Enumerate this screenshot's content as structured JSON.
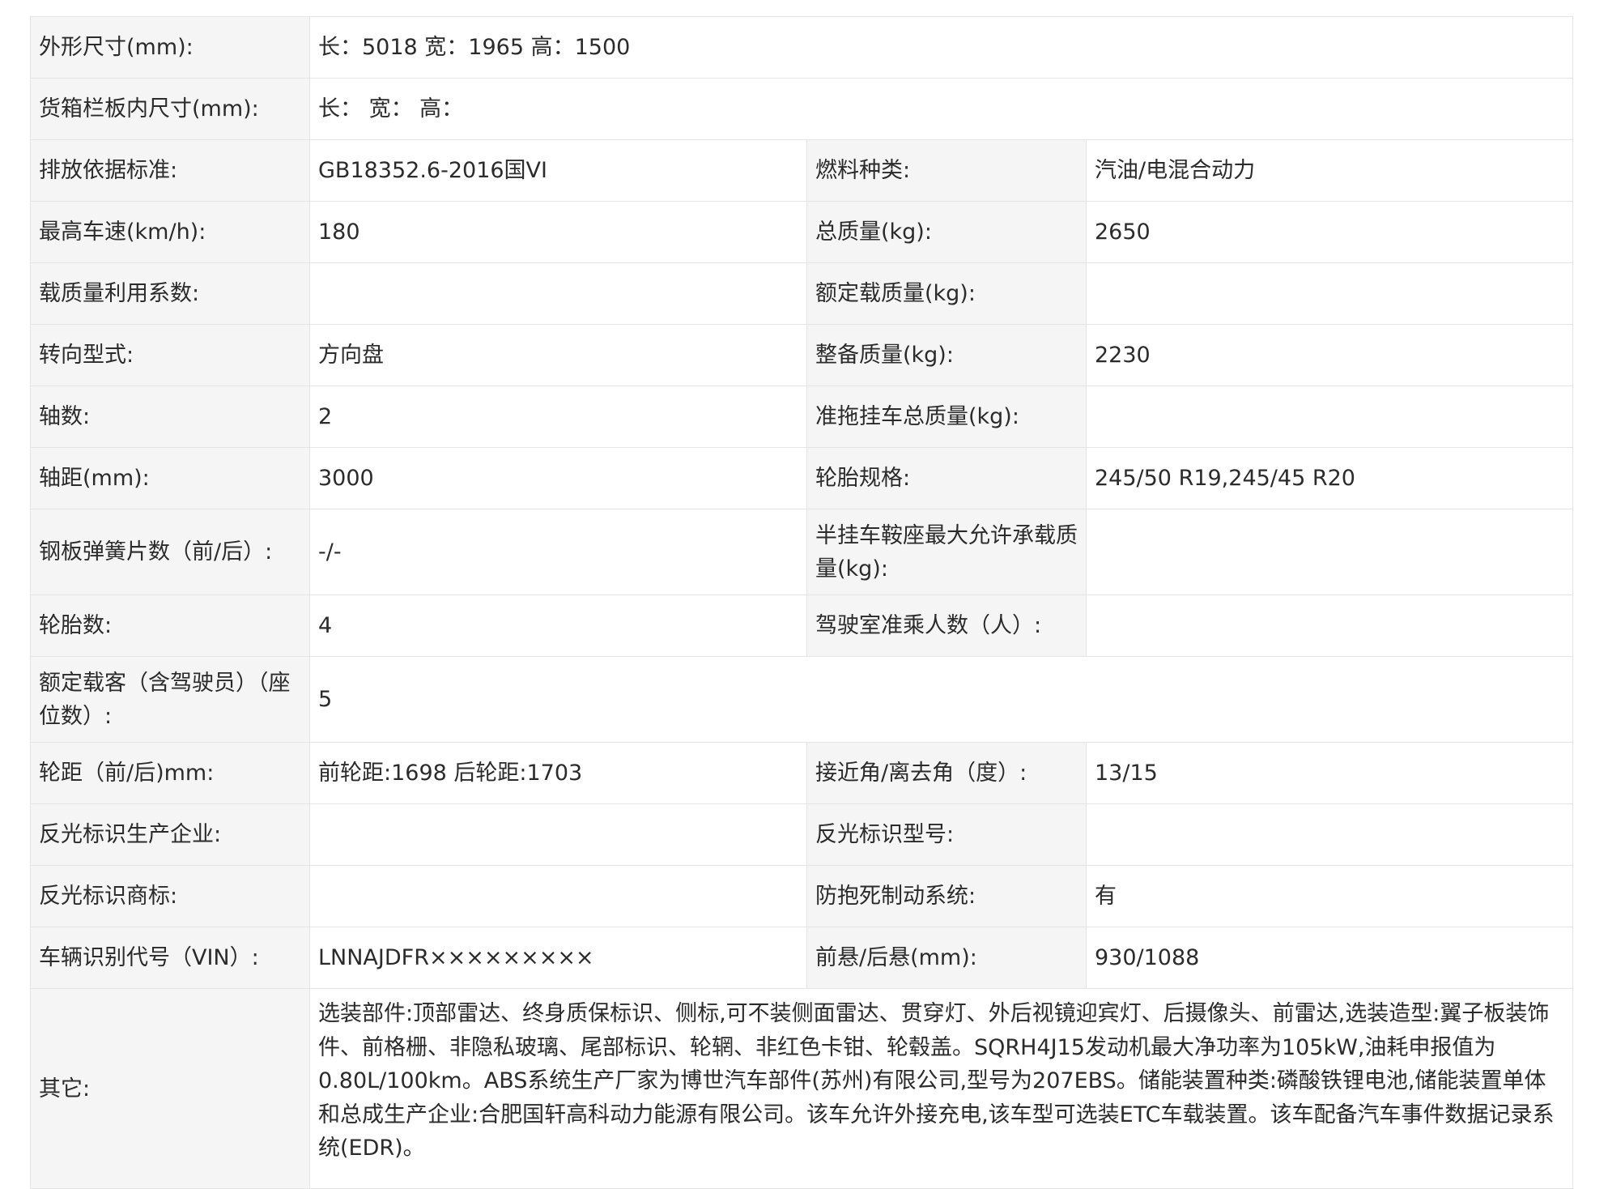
{
  "rows": {
    "dims": {
      "label": "外形尺寸(mm):",
      "value": "长：5018 宽：1965 高：1500"
    },
    "cargo": {
      "label": "货箱栏板内尺寸(mm):",
      "value": "长：  宽：  高："
    },
    "emission": {
      "label": "排放依据标准:",
      "value": "GB18352.6-2016国VI",
      "label2": "燃料种类:",
      "value2": "汽油/电混合动力"
    },
    "speed": {
      "label": "最高车速(km/h):",
      "value": "180",
      "label2": "总质量(kg):",
      "value2": "2650"
    },
    "load_factor": {
      "label": "载质量利用系数:",
      "value": "",
      "label2": "额定载质量(kg):",
      "value2": ""
    },
    "steering": {
      "label": "转向型式:",
      "value": "方向盘",
      "label2": "整备质量(kg):",
      "value2": "2230"
    },
    "axles": {
      "label": "轴数:",
      "value": "2",
      "label2": "准拖挂车总质量(kg):",
      "value2": ""
    },
    "wheelbase": {
      "label": "轴距(mm):",
      "value": "3000",
      "label2": "轮胎规格:",
      "value2": "245/50 R19,245/45 R20"
    },
    "springs": {
      "label": "钢板弹簧片数（前/后）:",
      "value": "-/-",
      "label2": "半挂车鞍座最大允许承载质量(kg):",
      "value2": ""
    },
    "tires": {
      "label": "轮胎数:",
      "value": "4",
      "label2": "驾驶室准乘人数（人）:",
      "value2": ""
    },
    "seats": {
      "label": "额定载客（含驾驶员）（座位数）:",
      "value": "5"
    },
    "track": {
      "label": "轮距（前/后)mm:",
      "value": "前轮距:1698 后轮距:1703",
      "label2": "接近角/离去角（度）:",
      "value2": "13/15"
    },
    "reflector_maker": {
      "label": "反光标识生产企业:",
      "value": "",
      "label2": "反光标识型号:",
      "value2": ""
    },
    "reflector_brand": {
      "label": "反光标识商标:",
      "value": "",
      "label2": "防抱死制动系统:",
      "value2": "有"
    },
    "vin": {
      "label": "车辆识别代号（VIN）:",
      "value": "LNNAJDFR×××××××××",
      "label2": "前悬/后悬(mm):",
      "value2": "930/1088"
    },
    "other": {
      "label": "其它:",
      "value": "选装部件:顶部雷达、终身质保标识、侧标,可不装侧面雷达、贯穿灯、外后视镜迎宾灯、后摄像头、前雷达,选装造型:翼子板装饰件、前格栅、非隐私玻璃、尾部标识、轮辋、非红色卡钳、轮毂盖。SQRH4J15发动机最大净功率为105kW,油耗申报值为0.80L/100km。ABS系统生产厂家为博世汽车部件(苏州)有限公司,型号为207EBS。储能装置种类:磷酸铁锂电池,储能装置单体和总成生产企业:合肥国轩高科动力能源有限公司。该车允许外接充电,该车型可选装ETC车载装置。该车配备汽车事件数据记录系统(EDR)。"
    }
  }
}
